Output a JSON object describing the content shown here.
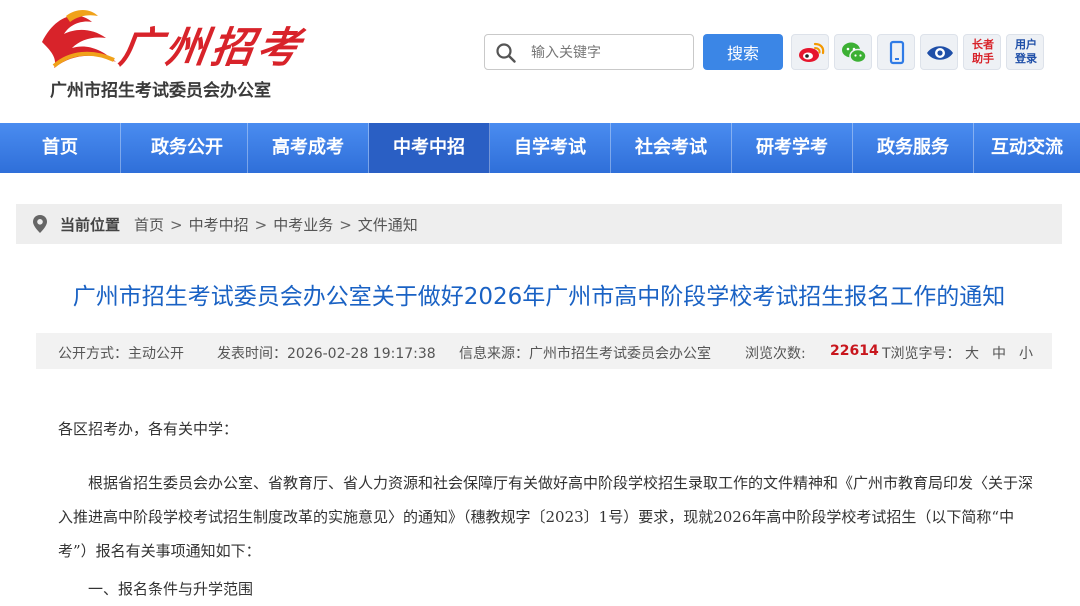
{
  "header": {
    "logo_text": "广州招考",
    "org_name": "广州市招生考试委员会办公室",
    "search": {
      "placeholder": "输入关键字",
      "button_label": "搜索"
    },
    "tools": [
      {
        "icon": "weibo-icon"
      },
      {
        "icon": "wechat-icon"
      },
      {
        "icon": "mobile-icon"
      },
      {
        "icon": "eye-icon"
      },
      {
        "icon": "elder-assist-icon",
        "label_line1": "长者",
        "label_line2": "助手"
      },
      {
        "icon": "user-login-icon",
        "label_line1": "用户",
        "label_line2": "登录"
      }
    ]
  },
  "nav": {
    "items": [
      "首页",
      "政务公开",
      "高考成考",
      "中考中招",
      "自学考试",
      "社会考试",
      "研考学考",
      "政务服务",
      "互动交流"
    ],
    "active_index": 3
  },
  "breadcrumb": {
    "title": "当前位置",
    "items": [
      "首页",
      "中考中招",
      "中考业务",
      "文件通知"
    ],
    "separator": ">"
  },
  "article": {
    "title": "广州市招生考试委员会办公室关于做好2026年广州市高中阶段学校考试招生报名工作的通知",
    "meta": {
      "disclosure": "公开方式：主动公开",
      "published": "发表时间：2026-02-28 19:17:38",
      "source": "信息来源：广州市招生考试委员会办公室",
      "views_label": "浏览次数:",
      "views_value": "22614",
      "font_size_label": "T浏览字号：",
      "font_sizes": [
        "大",
        "中",
        "小"
      ]
    },
    "greeting": "各区招考办，各有关中学：",
    "paragraph": "根据省招生委员会办公室、省教育厅、省人力资源和社会保障厅有关做好高中阶段学校招生录取工作的文件精神和《广州市教育局印发〈关于深入推进高中阶段学校考试招生制度改革的实施意见〉的通知》（穗教规字〔2023〕1号）要求，现就2026年高中阶段学校考试招生（以下简称“中考”）报名有关事项通知如下：",
    "section_heading": "一、报名条件与升学范围"
  },
  "colors": {
    "nav_blue": "#3b7ee6",
    "nav_active": "#2a5fc4",
    "title_blue": "#1a62c4",
    "views_red": "#c8161d",
    "logo_red": "#d8232a"
  }
}
